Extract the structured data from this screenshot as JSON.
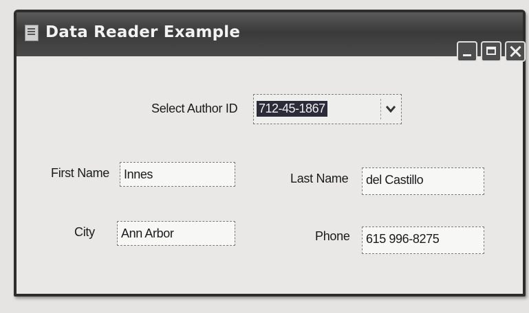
{
  "window": {
    "title": "Data Reader Example"
  },
  "form": {
    "author_id_label": "Select Author ID",
    "author_id_value": "712-45-1867",
    "first_name_label": "First Name",
    "first_name_value": "Innes",
    "last_name_label": "Last Name",
    "last_name_value": "del Castillo",
    "city_label": "City",
    "city_value": "Ann Arbor",
    "phone_label": "Phone",
    "phone_value": "615 996-8275"
  },
  "icons": {
    "app": "app-window-icon",
    "minimize": "minimize-icon",
    "maximize": "maximize-icon",
    "close": "close-icon",
    "dropdown": "chevron-down-icon"
  }
}
